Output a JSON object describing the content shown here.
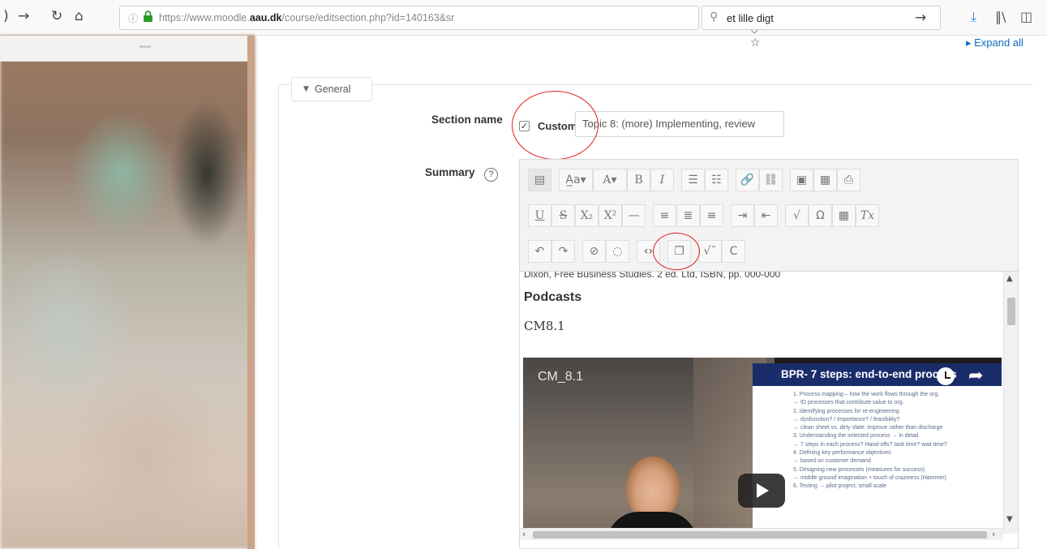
{
  "browser": {
    "url_prefix": "https://www.moodle.",
    "url_domain": "aau.dk",
    "url_suffix": "/course/editsection.php?id=140163&sr",
    "url_actions": "··· ⛉ ☆",
    "search_text": "et lille digt"
  },
  "page": {
    "expand_all": "▸ Expand all",
    "general_legend": "General",
    "section_name_label": "Section name",
    "custom_label": "Custom",
    "section_name_value": "Topic 8: (more) Implementing, review",
    "summary_label": "Summary",
    "help_symbol": "?"
  },
  "editor": {
    "toolbar_row1": [
      "▤",
      "A̲a▾",
      "A▾",
      "B",
      "I",
      "☰",
      "☷",
      "🔗",
      "⛓",
      "▣",
      "▦",
      "⎙"
    ],
    "toolbar_row2": [
      "U",
      "S",
      "X₂",
      "X²",
      "—",
      "≡",
      "≣",
      "≡",
      "⇥",
      "⇤",
      "√",
      "Ω",
      "▦",
      "Tx"
    ],
    "toolbar_row3": [
      "↶",
      "↷",
      "⊘",
      "◌",
      "‹›",
      "❐",
      "√ˉ",
      "C"
    ],
    "truncated_line": "Dixon, Free Business Studies. 2 ed. Ltd, ISBN, pp. 000-000",
    "podcasts_heading": "Podcasts",
    "cm_label": "CM8.1"
  },
  "video": {
    "title": "CM_8.1",
    "slide_title": "BPR- 7 steps: end-to-end process",
    "slide_lines": [
      "1.  Process mapping – how the work flows through the org.",
      "     → ID processes that contribute value to org.",
      "2.  Identifying processes for re-engineering",
      "     → dysfunction? / Importance? / feasibility?",
      "     → clean sheet vs. dirty slate: improve rather than discharge",
      "3.  Understanding the selected process → in detail",
      "     → 7 steps in each process? Hand-offs? task time? wait time?",
      "4.  Defining key performance objectives",
      "     → based on customer demand",
      "5.  Designing new processes (measures for success)",
      "     → middle ground imagination + touch of craziness (Hammer)",
      "6.  Testing → pilot project, small scale"
    ]
  }
}
